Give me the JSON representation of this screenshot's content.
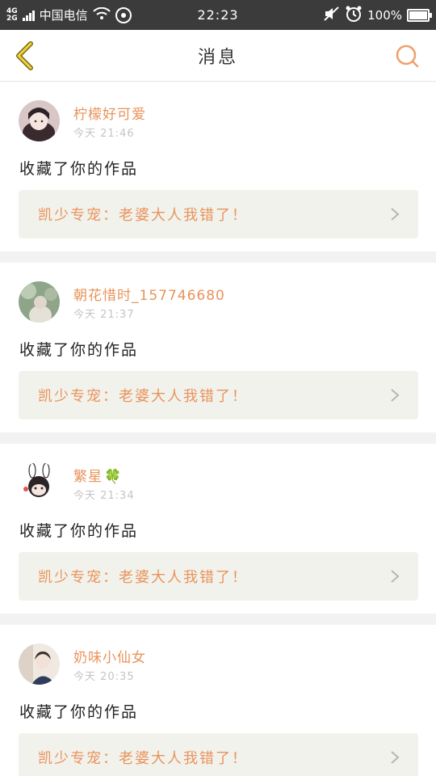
{
  "status_bar": {
    "net_top": "4G",
    "net_bottom": "2G",
    "carrier": "中国电信",
    "time": "22:23",
    "battery": "100%",
    "battery_level": 1.0
  },
  "header": {
    "title": "消息",
    "back_icon": "chevron-left-icon",
    "search_icon": "search-icon",
    "accent_color": "#e9935b"
  },
  "messages": [
    {
      "username": "柠檬好可爱",
      "time": "今天 21:46",
      "action": "收藏了你的作品",
      "work_title": "凯少专宠：老婆大人我错了！"
    },
    {
      "username": "朝花惜时_157746680",
      "time": "今天 21:37",
      "action": "收藏了你的作品",
      "work_title": "凯少专宠：老婆大人我错了！"
    },
    {
      "username": "繁星",
      "emoji": "🍀",
      "time": "今天 21:34",
      "action": "收藏了你的作品",
      "work_title": "凯少专宠：老婆大人我错了！"
    },
    {
      "username": "奶味小仙女",
      "time": "今天 20:35",
      "action": "收藏了你的作品",
      "work_title": "凯少专宠：老婆大人我错了！"
    }
  ]
}
